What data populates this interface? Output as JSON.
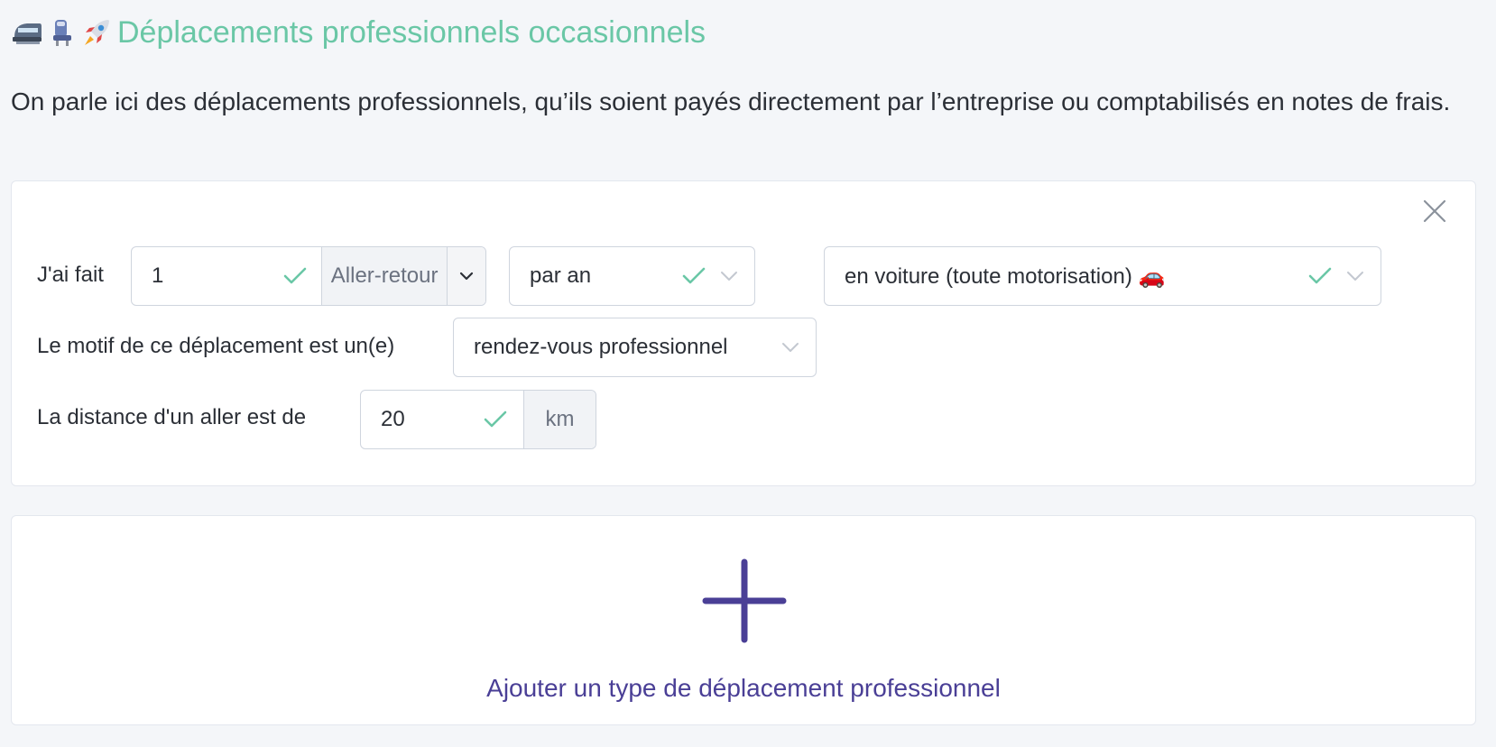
{
  "header": {
    "title": "Déplacements professionnels occasionnels",
    "emoji_icons": [
      "train-icon",
      "seat-icon",
      "rocket-icon"
    ]
  },
  "intro": "On parle ici des déplacements professionnels, qu’ils soient payés directement par l’entreprise ou comptabilisés en notes de frais.",
  "form": {
    "row1": {
      "label": "J'ai fait",
      "count_value": "1",
      "trip_type": "Aller-retour",
      "frequency": "par an",
      "transport_mode": "en voiture (toute motorisation) 🚗"
    },
    "row2": {
      "label": "Le motif de ce déplacement est un(e)",
      "reason": "rendez-vous professionnel"
    },
    "row3": {
      "label": "La distance d'un aller est de",
      "distance_value": "20",
      "unit": "km"
    }
  },
  "add_card": {
    "label": "Ajouter un type de déplacement professionnel"
  },
  "colors": {
    "title": "#6ac7a6",
    "check": "#6ac7a6",
    "accent": "#4a3f96",
    "background": "#f4f6f9"
  }
}
